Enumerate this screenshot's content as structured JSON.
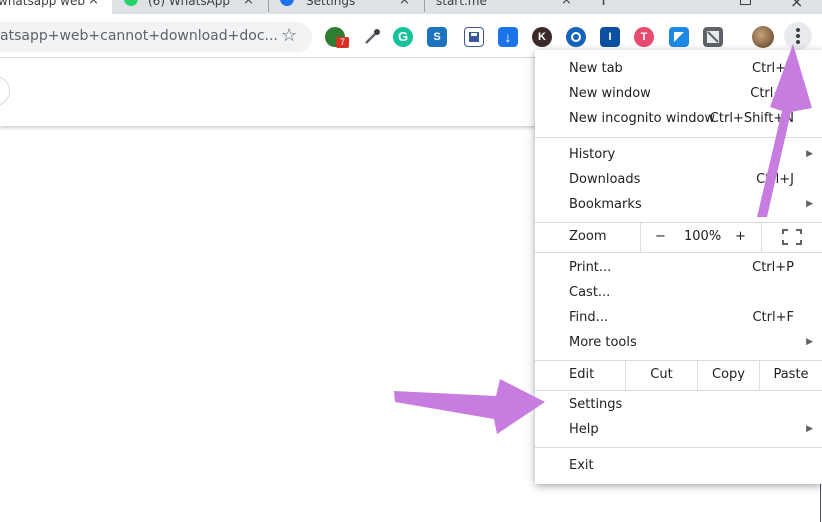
{
  "tabs": [
    {
      "title": "whatsapp web",
      "active": true
    },
    {
      "title": "(6) WhatsApp",
      "active": false
    },
    {
      "title": "Settings",
      "active": false
    },
    {
      "title": "start.me",
      "active": false
    }
  ],
  "tab_close_glyph": "×",
  "new_tab_glyph": "+",
  "toolbar": {
    "omnibox_text": "atsapp+web+cannot+download+doc...",
    "star_icon": "star-icon",
    "extensions": [
      {
        "name": "extension-a-icon",
        "glyph": "",
        "color": "#2e7d32"
      },
      {
        "name": "eyedropper-icon",
        "glyph": "✎",
        "color": "#5f6368"
      },
      {
        "name": "grammarly-icon",
        "glyph": "G",
        "color": "#15c39a"
      },
      {
        "name": "extension-s-icon",
        "glyph": "S",
        "color": "#1e73be"
      },
      {
        "name": "extension-save-icon",
        "glyph": "",
        "color": "#3b5998"
      },
      {
        "name": "download-icon",
        "glyph": "↓",
        "color": "#1a73e8"
      },
      {
        "name": "extension-k-icon",
        "glyph": "K",
        "color": "#3c2a2a"
      },
      {
        "name": "extension-blue-icon",
        "glyph": "",
        "color": "#1565c0"
      },
      {
        "name": "extension-i-icon",
        "glyph": "I",
        "color": "#0b4fa0"
      },
      {
        "name": "extension-t-icon",
        "glyph": "T",
        "color": "#e84a6d"
      },
      {
        "name": "extension-square-icon",
        "glyph": "",
        "color": "#1e88e5"
      },
      {
        "name": "extension-gray-icon",
        "glyph": "",
        "color": "#5f6368"
      }
    ],
    "badge_count": "7"
  },
  "menu": {
    "new_tab": {
      "label": "New tab",
      "shortcut": "Ctrl+T"
    },
    "new_window": {
      "label": "New window",
      "shortcut": "Ctrl+N"
    },
    "new_incognito": {
      "label": "New incognito window",
      "shortcut": "Ctrl+Shift+N"
    },
    "history": {
      "label": "History"
    },
    "downloads": {
      "label": "Downloads",
      "shortcut": "Ctrl+J"
    },
    "bookmarks": {
      "label": "Bookmarks"
    },
    "zoom": {
      "label": "Zoom",
      "minus": "−",
      "value": "100%",
      "plus": "+"
    },
    "print": {
      "label": "Print...",
      "shortcut": "Ctrl+P"
    },
    "cast": {
      "label": "Cast..."
    },
    "find": {
      "label": "Find...",
      "shortcut": "Ctrl+F"
    },
    "more_tools": {
      "label": "More tools"
    },
    "edit": {
      "label": "Edit",
      "cut": "Cut",
      "copy": "Copy",
      "paste": "Paste"
    },
    "settings": {
      "label": "Settings"
    },
    "help": {
      "label": "Help"
    },
    "exit": {
      "label": "Exit"
    },
    "submenu_arrow": "▶"
  },
  "colors": {
    "annotation_arrow": "#c77ddf"
  }
}
